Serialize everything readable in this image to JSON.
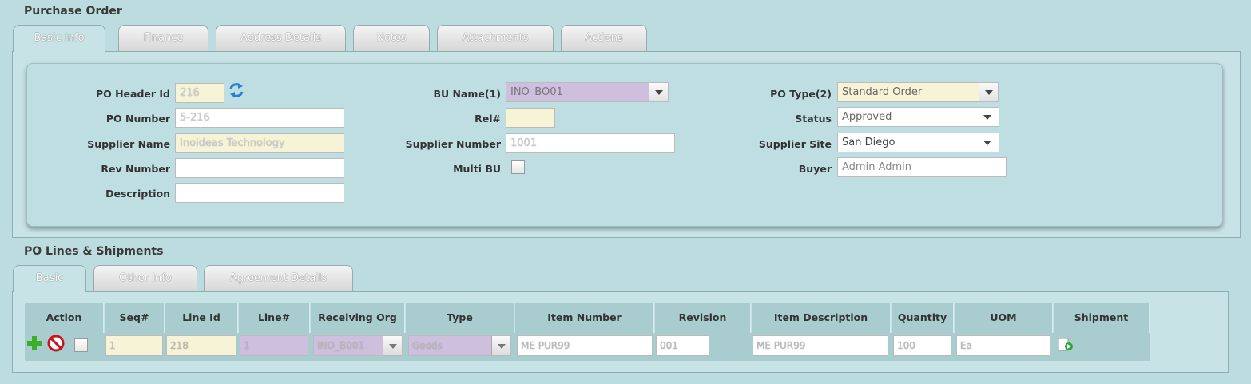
{
  "header": {
    "title": "Purchase Order"
  },
  "header_tabs": [
    "Basic Info",
    "Finance",
    "Address Details",
    "Notes",
    "Attachments",
    "Actions"
  ],
  "form": {
    "po_header_id": {
      "label": "PO Header Id",
      "value": "216"
    },
    "po_number": {
      "label": "PO Number",
      "value": "5-216"
    },
    "supplier_name": {
      "label": "Supplier Name",
      "value": "Inoideas Technology"
    },
    "rev_number": {
      "label": "Rev Number",
      "value": ""
    },
    "description": {
      "label": "Description",
      "value": ""
    },
    "bu_name": {
      "label": "BU Name(1)",
      "value": "INO_BO01"
    },
    "rel": {
      "label": "Rel#",
      "value": ""
    },
    "supplier_number": {
      "label": "Supplier Number",
      "value": "1001"
    },
    "multi_bu": {
      "label": "Multi BU"
    },
    "po_type": {
      "label": "PO Type(2)",
      "value": "Standard Order"
    },
    "status": {
      "label": "Status",
      "value": "Approved"
    },
    "supplier_site": {
      "label": "Supplier Site",
      "value": "San Diego"
    },
    "buyer": {
      "label": "Buyer",
      "value": "Admin Admin"
    }
  },
  "lines": {
    "title": "PO Lines & Shipments",
    "tabs": [
      "Basic",
      "Other Info",
      "Agreement Details"
    ],
    "columns": [
      "Action",
      "Seq#",
      "Line Id",
      "Line#",
      "Receiving Org",
      "Type",
      "Item Number",
      "Revision Number",
      "Item Description",
      "Quantity",
      "UOM",
      "Shipment Details"
    ],
    "rows": [
      {
        "seq": "1",
        "line_id": "218",
        "line_num": "1",
        "receiving_org": "INO_B001",
        "type": "Goods",
        "item_number": "ME PUR99",
        "revision_number": "001",
        "item_description": "ME PUR99",
        "quantity": "100",
        "uom": "Ea"
      }
    ]
  },
  "colors": {
    "background": "#bcdcdf",
    "panel": "#c8e3e6",
    "grid_header": "#a9cccf",
    "field_yellow": "#f7f3d6",
    "field_purple": "#cdbfdd"
  },
  "icons": [
    "refresh-icon",
    "add-icon",
    "delete-icon",
    "shipment-details-icon"
  ]
}
